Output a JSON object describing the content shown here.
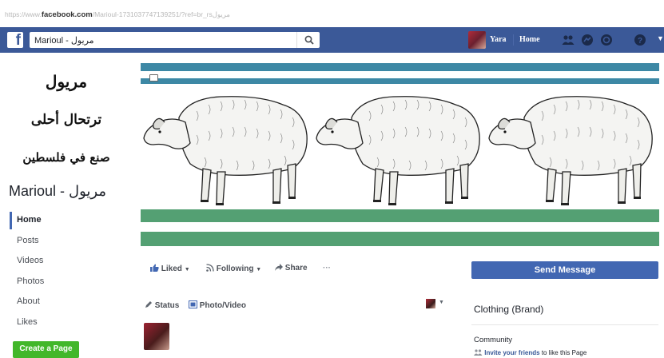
{
  "browser": {
    "url_prefix": "https://www.",
    "url_domain": "facebook.com",
    "url_path": "/Marioul-1731037747139251/?ref=br_rs",
    "url_tail": "مريول"
  },
  "topnav": {
    "logo_letter": "f",
    "search_value": "Marioul - مريول",
    "user_name": "Yara",
    "home_label": "Home",
    "bg_color": "#3b5998"
  },
  "left": {
    "art_line1": "مريول",
    "art_line2": "ترتحال أحلى",
    "art_line3": "صنع في فلسطين",
    "page_name": "Marioul - مريول",
    "nav": [
      {
        "label": "Home",
        "active": true
      },
      {
        "label": "Posts"
      },
      {
        "label": "Videos"
      },
      {
        "label": "Photos"
      },
      {
        "label": "About"
      },
      {
        "label": "Likes"
      }
    ],
    "create_page_label": "Create a Page"
  },
  "cover": {
    "stripe_blue": "#3d88a5",
    "stripe_green": "#54a073",
    "sheep_icon": "sheep-icon"
  },
  "actions": {
    "liked_label": "Liked",
    "following_label": "Following",
    "share_label": "Share",
    "more_label": "···",
    "send_message_label": "Send Message"
  },
  "composer": {
    "status_label": "Status",
    "photo_video_label": "Photo/Video"
  },
  "right": {
    "category": "Clothing (Brand)",
    "community_title": "Community",
    "invite_link": "Invite your friends",
    "invite_rest": "to like this Page"
  }
}
